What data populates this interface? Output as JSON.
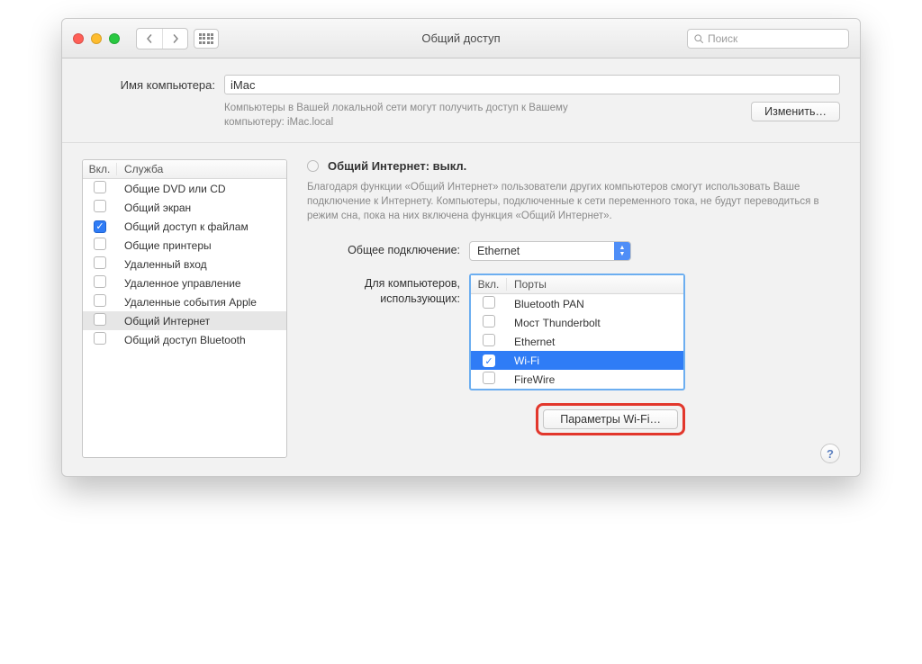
{
  "window": {
    "title": "Общий доступ",
    "search_placeholder": "Поиск"
  },
  "computer_name": {
    "label": "Имя компьютера:",
    "value": "iMac",
    "hint": "Компьютеры в Вашей локальной сети могут получить доступ к Вашему компьютеру: iMac.local",
    "edit_button": "Изменить…"
  },
  "services": {
    "header_on": "Вкл.",
    "header_service": "Служба",
    "items": [
      {
        "label": "Общие DVD или CD",
        "checked": false,
        "selected": false
      },
      {
        "label": "Общий экран",
        "checked": false,
        "selected": false
      },
      {
        "label": "Общий доступ к файлам",
        "checked": true,
        "selected": false
      },
      {
        "label": "Общие принтеры",
        "checked": false,
        "selected": false
      },
      {
        "label": "Удаленный вход",
        "checked": false,
        "selected": false
      },
      {
        "label": "Удаленное управление",
        "checked": false,
        "selected": false
      },
      {
        "label": "Удаленные события Apple",
        "checked": false,
        "selected": false
      },
      {
        "label": "Общий Интернет",
        "checked": false,
        "selected": true
      },
      {
        "label": "Общий доступ Bluetooth",
        "checked": false,
        "selected": false
      }
    ]
  },
  "detail": {
    "status_label": "Общий Интернет: выкл.",
    "description": "Благодаря функции «Общий Интернет» пользователи других компьютеров смогут использовать Ваше подключение к Интернету. Компьютеры, подключенные к сети переменного тока, не будут переводиться в режим сна, пока на них включена функция «Общий Интернет».",
    "share_from_label": "Общее подключение:",
    "share_from_value": "Ethernet",
    "to_computers_label": "Для компьютеров, использующих:",
    "ports_header_on": "Вкл.",
    "ports_header_ports": "Порты",
    "ports": [
      {
        "label": "Bluetooth PAN",
        "checked": false,
        "selected": false
      },
      {
        "label": "Мост Thunderbolt",
        "checked": false,
        "selected": false
      },
      {
        "label": "Ethernet",
        "checked": false,
        "selected": false
      },
      {
        "label": "Wi-Fi",
        "checked": true,
        "selected": true
      },
      {
        "label": "FireWire",
        "checked": false,
        "selected": false
      }
    ],
    "wifi_options_button": "Параметры Wi-Fi…"
  },
  "help_label": "?"
}
